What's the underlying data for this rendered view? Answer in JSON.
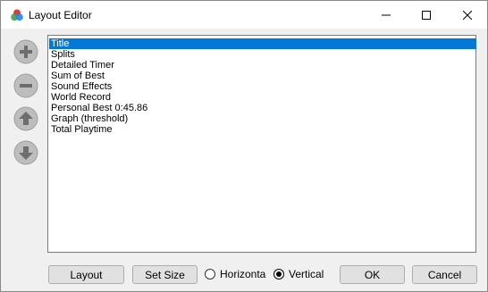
{
  "window": {
    "title": "Layout Editor"
  },
  "titlebar_buttons": {
    "minimize": "minimize-icon",
    "maximize": "maximize-icon",
    "close": "close-icon"
  },
  "side_buttons": [
    "plus-icon",
    "minus-icon",
    "arrow-up-icon",
    "arrow-down-icon"
  ],
  "components": [
    {
      "label": "Title",
      "selected": true
    },
    {
      "label": "Splits",
      "selected": false
    },
    {
      "label": "Detailed Timer",
      "selected": false
    },
    {
      "label": "Sum of Best",
      "selected": false
    },
    {
      "label": "Sound Effects",
      "selected": false
    },
    {
      "label": "World Record",
      "selected": false
    },
    {
      "label": "Personal Best 0:45.86",
      "selected": false
    },
    {
      "label": "Graph (threshold)",
      "selected": false
    },
    {
      "label": "Total Playtime",
      "selected": false
    }
  ],
  "bottom": {
    "layout_button": "Layout",
    "set_size_button": "Set Size",
    "horizontal_radio": "Horizonta",
    "vertical_radio": "Vertical",
    "selected_orientation": "Vertical",
    "ok_button": "OK",
    "cancel_button": "Cancel"
  },
  "colors": {
    "selection": "#0078d7",
    "side_button": "#b4b4b4",
    "side_button_glyph": "#6e6e6e"
  }
}
